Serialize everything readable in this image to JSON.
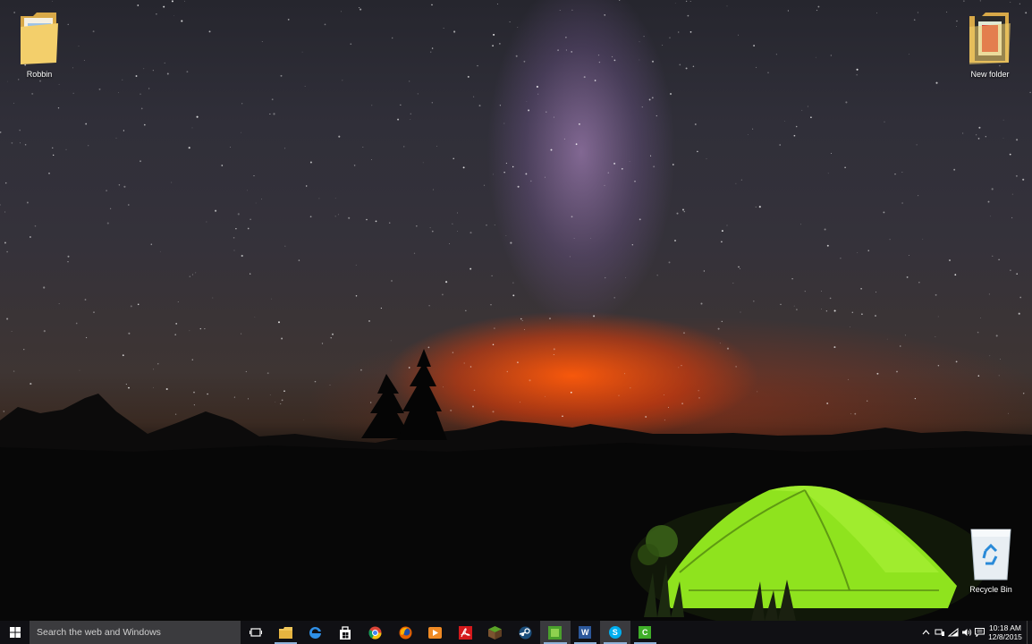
{
  "desktop": {
    "icons": [
      {
        "label": "Robbin",
        "icon": "folder-icon"
      },
      {
        "label": "New folder",
        "icon": "video-folder-icon"
      },
      {
        "label": "Recycle Bin",
        "icon": "recycle-bin-icon"
      }
    ]
  },
  "taskbar": {
    "start_icon": "windows-logo-icon",
    "search_placeholder": "Search the web and Windows",
    "apps": [
      {
        "name": "task-view",
        "icon": "task-view-icon"
      },
      {
        "name": "file-explorer",
        "icon": "folder-icon"
      },
      {
        "name": "edge",
        "icon": "edge-icon"
      },
      {
        "name": "store",
        "icon": "store-icon"
      },
      {
        "name": "chrome",
        "icon": "chrome-icon"
      },
      {
        "name": "firefox",
        "icon": "firefox-icon"
      },
      {
        "name": "media-player",
        "icon": "play-icon"
      },
      {
        "name": "acrobat",
        "icon": "pdf-icon"
      },
      {
        "name": "minecraft",
        "icon": "grass-block-icon"
      },
      {
        "name": "steam",
        "icon": "steam-icon"
      },
      {
        "name": "camtasia",
        "icon": "green-app-icon"
      },
      {
        "name": "word",
        "icon": "word-icon",
        "letter": "W"
      },
      {
        "name": "skype",
        "icon": "skype-icon",
        "letter": "S"
      },
      {
        "name": "recorder",
        "icon": "green-c-icon",
        "letter": "C"
      }
    ],
    "tray": {
      "icons": [
        "chevron-up-icon",
        "network-alt-icon",
        "wifi-icon",
        "volume-icon",
        "action-center-icon"
      ],
      "time": "10:18 AM",
      "date": "12/8/2015"
    }
  },
  "colors": {
    "taskbar": "#101014",
    "search_box": "#3b3b3e",
    "tent": "#8fe31e",
    "horizon_glow": "#ff5a0a"
  }
}
